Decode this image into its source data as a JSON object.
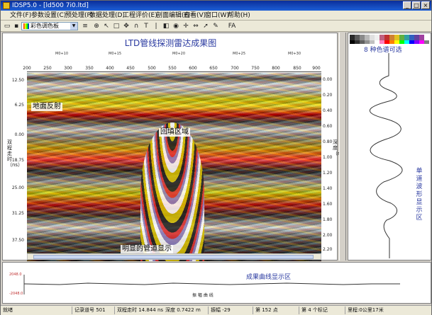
{
  "window": {
    "title": "IDSP5.0 - [ld500 7i0.ltd]"
  },
  "menu": [
    "文件(F)",
    "参数设置(C)",
    "预处理(P)",
    "数据处理(D)",
    "工程评价(E)",
    "剖面编辑(F)",
    "查看(V)",
    "窗口(W)",
    "帮助(H)"
  ],
  "toolbar": {
    "palette_combo": "彩色调色板",
    "tool_t": "T",
    "tool_fa": "FA"
  },
  "document": {
    "title": "LTD管线探测雷达成果图",
    "marks": [
      "M0+10",
      "M0+15",
      "M0+20",
      "M0+25",
      "M0+30"
    ],
    "distance_ticks": [
      "200",
      "250",
      "300",
      "350",
      "400",
      "450",
      "500",
      "550",
      "600",
      "650",
      "700",
      "750",
      "800",
      "850",
      "900"
    ],
    "left_ticks": [
      "12.50",
      "6.25",
      "0.00",
      "18.75",
      "25.00",
      "31.25",
      "37.50"
    ],
    "right_ticks": [
      "0.00",
      "0.20",
      "0.40",
      "0.60",
      "0.80",
      "1.00",
      "1.20",
      "1.40",
      "1.60",
      "1.80",
      "2.00",
      "2.20"
    ],
    "left_axis_title": "双程走时（ns）",
    "right_axis_title": "深度（m）",
    "callouts": {
      "surface": "地面反射",
      "backfill": "回填区域",
      "pipe": "明显的管道显示"
    }
  },
  "side_panel": {
    "note": "8 种色谱可选",
    "vertical_label": "单道波形显示区",
    "palette_top": [
      "#2a2a2a",
      "#5a5a5a",
      "#8a8a8a",
      "#b8b8b8",
      "#e0e0e0",
      "#f0f0f0",
      "#c06080",
      "#c03030",
      "#d08030",
      "#e0c020",
      "#60b040",
      "#30a0a0",
      "#3060c0",
      "#6040a0",
      "#a040a0",
      "#ffffff"
    ],
    "palette_bottom": [
      "#000000",
      "#303030",
      "#606060",
      "#909090",
      "#c0c0c0",
      "#ffffff",
      "#ff80c0",
      "#ff0000",
      "#ff8000",
      "#ffff00",
      "#00ff00",
      "#00ffff",
      "#0000ff",
      "#8000ff",
      "#ff00ff",
      "#808080"
    ]
  },
  "bottom_panel": {
    "title": "成果曲线显示区",
    "y_top": "2048.0",
    "y_bottom": "-2048.0",
    "x_label": "振  幅  曲  线"
  },
  "status": {
    "ready": "就绪",
    "trace": "记录道号 501",
    "twt": "双程走时 14.844 ns",
    "depth": "深度 0.7422 m",
    "amplitude": "振幅 -29",
    "record": "第 152 点",
    "marker": "第 4 个标记",
    "mileage": "里程:0公里17米"
  },
  "colors": {
    "accent": "#2a3aa0",
    "title_bar": "#1d5fd6"
  }
}
